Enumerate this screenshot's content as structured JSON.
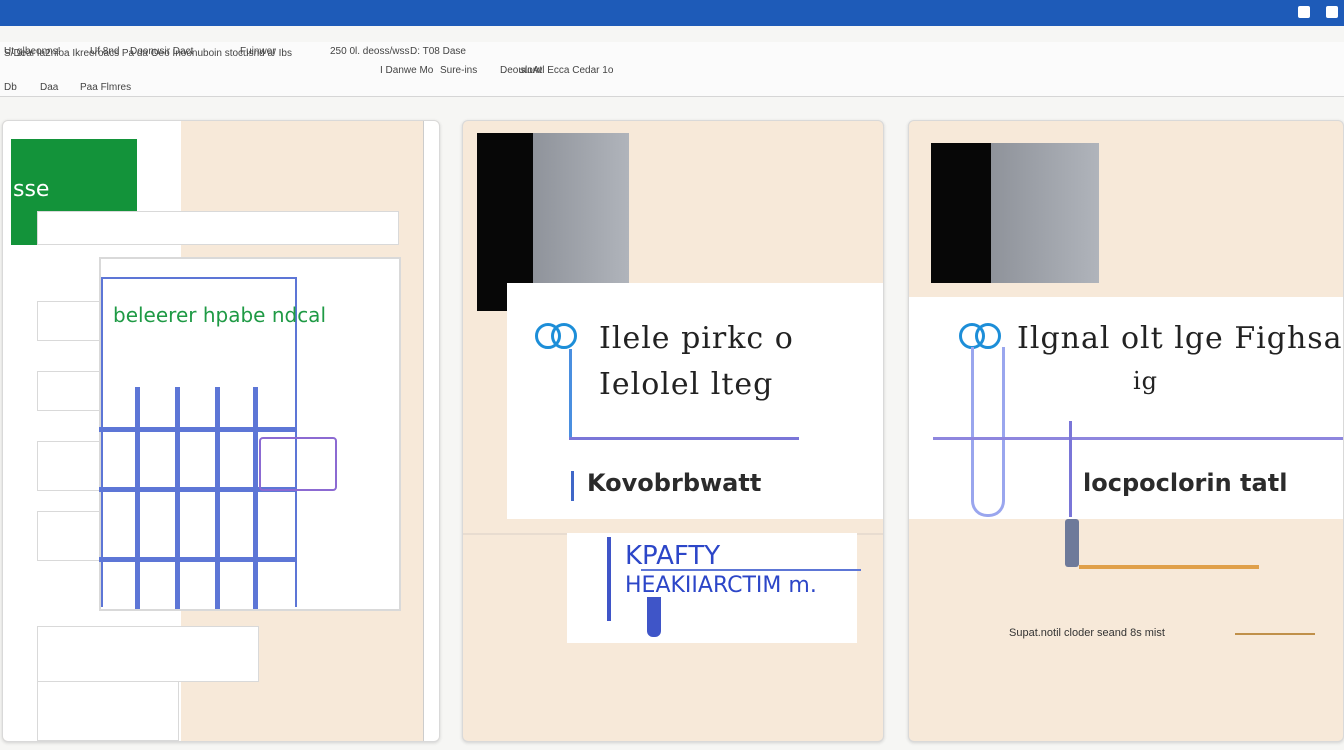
{
  "toolbar": {
    "row1": [
      "Ut g|beonns!",
      "Uf 8nd",
      "Doonusir Dact",
      "Fuinwer",
      "250 0l. deoss/wss",
      "D: T08 Dase"
    ],
    "row1_long": "S/Deai Ia2nloa Ikreeroacs Pa da Oeo Inoonuboin stocusnd a/ Ibs",
    "row2": [
      "I Danwe Mo",
      "Sure-ins",
      "Deouuuw",
      "sloAtl Ecca Cedar 1o"
    ],
    "row3": [
      "Db",
      "Daa",
      "Paa Flmres"
    ]
  },
  "panel1": {
    "tab_text": "sse",
    "heading": "beleerer hpabe ndcal"
  },
  "panel2": {
    "title_line1": "Ilele pirkc o",
    "title_line2": "Ielolel lteg",
    "label": "Kovobrbwatt",
    "blue_line1": "KPAFTY",
    "blue_line2": "HEAKIIARCTIM m."
  },
  "panel3": {
    "title_line1": "Ilgnal olt lge Fighsa",
    "title_line2": "ig",
    "label": "locpoclorin tatl",
    "caption": "Supat.notil cloder seand 8s mist"
  },
  "colors": {
    "titlebar": "#1e5bb8",
    "green_tab": "#13933a",
    "panel_bg": "#f7e9d9",
    "accent_blue": "#5d76d6",
    "icon_blue": "#1d8ed8"
  }
}
